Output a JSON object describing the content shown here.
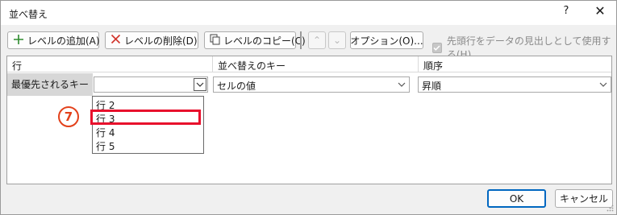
{
  "window": {
    "title": "並べ替え",
    "help_glyph": "?",
    "close_glyph": "✕"
  },
  "toolbar": {
    "add_level": "レベルの追加(A)",
    "delete_level": "レベルの削除(D)",
    "copy_level": "レベルのコピー(C)",
    "move_up_glyph": "⌃",
    "move_down_glyph": "⌄",
    "options": "オプション(O)...",
    "header_checkbox_label": "先頭行をデータの見出しとして使用する(H)",
    "header_checkbox_checked": true
  },
  "grid": {
    "columns": [
      "行",
      "並べ替えのキー",
      "順序"
    ],
    "row": {
      "label": "最優先されるキー",
      "column_value": "",
      "sort_on": "セルの値",
      "order": "昇順"
    }
  },
  "dropdown": {
    "items": [
      "行 2",
      "行 3",
      "行 4",
      "行 5"
    ],
    "highlighted_index": 1
  },
  "annotation": {
    "step_number": "7",
    "accent_color": "#e8102c"
  },
  "footer": {
    "ok": "OK",
    "cancel": "キャンセル"
  },
  "colors": {
    "primary_border": "#0067c0",
    "add_icon": "#2e8b2e",
    "delete_icon": "#d1342b"
  }
}
